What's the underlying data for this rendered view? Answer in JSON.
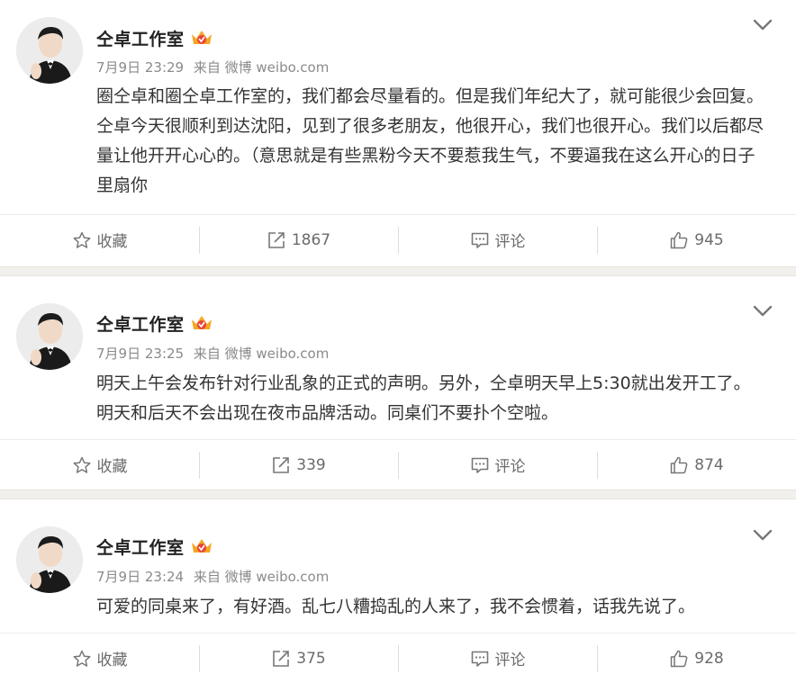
{
  "posts": [
    {
      "author": "仝卓工作室",
      "time": "7月9日 23:29",
      "source": "来自 微博 weibo.com",
      "text": "圈仝卓和圈仝卓工作室的，我们都会尽量看的。但是我们年纪大了，就可能很少会回复。仝卓今天很顺利到达沈阳，见到了很多老朋友，他很开心，我们也很开心。我们以后都尽量让他开开心心的。（意思就是有些黑粉今天不要惹我生气，不要逼我在这么开心的日子里扇你",
      "favorite_label": "收藏",
      "repost_count": "1867",
      "comment_label": "评论",
      "like_count": "945"
    },
    {
      "author": "仝卓工作室",
      "time": "7月9日 23:25",
      "source": "来自 微博 weibo.com",
      "text": "明天上午会发布针对行业乱象的正式的声明。另外，仝卓明天早上5:30就出发开工了。明天和后天不会出现在夜市品牌活动。同桌们不要扑个空啦。",
      "favorite_label": "收藏",
      "repost_count": "339",
      "comment_label": "评论",
      "like_count": "874"
    },
    {
      "author": "仝卓工作室",
      "time": "7月9日 23:24",
      "source": "来自 微博 weibo.com",
      "text": "可爱的同桌来了，有好酒。乱七八糟捣乱的人来了，我不会惯着，话我先说了。",
      "favorite_label": "收藏",
      "repost_count": "375",
      "comment_label": "评论",
      "like_count": "928"
    }
  ],
  "icons": {
    "vip": "vip-crown-icon",
    "menu": "chevron-down-icon",
    "favorite": "star-icon",
    "repost": "share-icon",
    "comment": "comment-icon",
    "like": "thumbs-up-icon"
  },
  "colors": {
    "separator": "#f2f0ec",
    "vip_gold": "#f5a623",
    "vip_red": "#e8453c",
    "meta_gray": "#8a8a8a",
    "text": "#333333"
  }
}
